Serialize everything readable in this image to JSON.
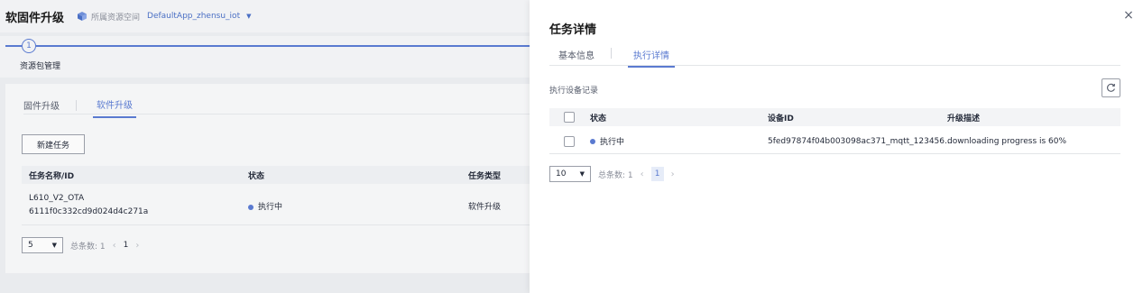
{
  "header": {
    "title": "软固件升级",
    "workspace_label": "所属资源空间",
    "workspace_value": "DefaultApp_zhensu_iot",
    "workspace_icon": "cube-icon"
  },
  "stepper": {
    "step_number": "1",
    "step_label": "资源包管理"
  },
  "main": {
    "tabs": [
      {
        "label": "固件升级"
      },
      {
        "label": "软件升级"
      }
    ],
    "active_tab": "软件升级",
    "new_task_label": "新建任务",
    "columns": [
      "任务名称/ID",
      "状态",
      "任务类型"
    ],
    "rows": [
      {
        "name": "L610_V2_OTA",
        "id": "6111f0c332cd9d024d4c271a",
        "status": "执行中",
        "type": "软件升级"
      }
    ],
    "pager": {
      "page_size": "5",
      "total_label": "总条数: 1",
      "page": "1"
    }
  },
  "drawer": {
    "title": "任务详情",
    "tabs": [
      {
        "label": "基本信息"
      },
      {
        "label": "执行详情"
      }
    ],
    "active_tab": "执行详情",
    "section_label": "执行设备记录",
    "columns": [
      "状态",
      "设备ID",
      "升级描述"
    ],
    "rows": [
      {
        "status": "执行中",
        "device_id": "5fed97874f04b003098ac371_mqtt_123456...",
        "description": "downloading progress is 60%"
      }
    ],
    "pager": {
      "page_size": "10",
      "total_label": "总条数: 1",
      "page": "1"
    }
  },
  "colors": {
    "accent": "#5a7ad0",
    "status_running": "#5a7ad0"
  }
}
